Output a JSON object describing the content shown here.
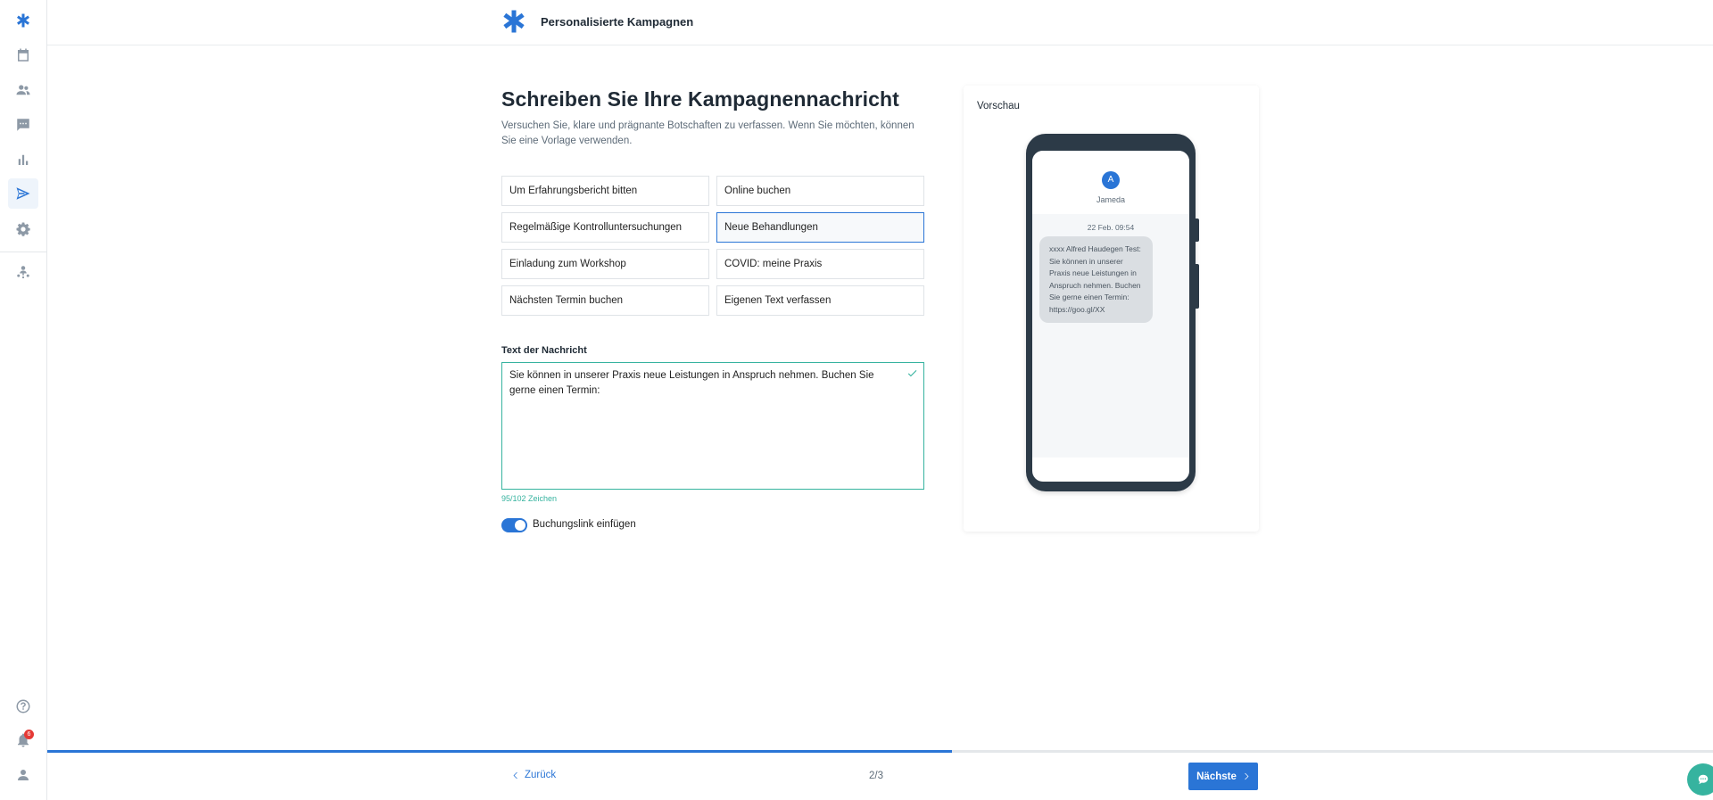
{
  "header": {
    "title": "Personalisierte Kampagnen"
  },
  "main": {
    "title": "Schreiben Sie Ihre Kampagnennachricht",
    "subtitle": "Versuchen Sie, klare und prägnante Botschaften zu verfassen. Wenn Sie möchten, können Sie eine Vorlage verwenden.",
    "templates": [
      {
        "label": "Um Erfahrungsbericht bitten",
        "selected": false
      },
      {
        "label": "Online buchen",
        "selected": false
      },
      {
        "label": "Regelmäßige Kontrolluntersuchungen",
        "selected": false
      },
      {
        "label": "Neue Behandlungen",
        "selected": true
      },
      {
        "label": "Einladung zum Workshop",
        "selected": false
      },
      {
        "label": "COVID: meine Praxis",
        "selected": false
      },
      {
        "label": "Nächsten Termin buchen",
        "selected": false
      },
      {
        "label": "Eigenen Text verfassen",
        "selected": false
      }
    ],
    "message_label": "Text der Nachricht",
    "message_value": "Sie können in unserer Praxis neue Leistungen in Anspruch nehmen. Buchen Sie gerne einen Termin:",
    "char_counter": "95/102 Zeichen",
    "toggle_label": "Buchungslink einfügen",
    "toggle_on": true
  },
  "preview": {
    "title": "Vorschau",
    "avatar_letter": "A",
    "contact_name": "Jameda",
    "timestamp": "22 Feb. 09:54",
    "message": "xxxx Alfred Haudegen Test: Sie können in unserer Praxis neue Leistungen in Anspruch nehmen. Buchen Sie gerne einen Termin: https://goo.gl/XX"
  },
  "footer": {
    "back_label": "Zurück",
    "step": "2/3",
    "next_label": "Nächste",
    "progress_fraction": 0.543
  },
  "sidebar": {
    "items": [
      "logo-icon",
      "calendar-icon",
      "users-icon",
      "chat-icon",
      "bar-chart-icon",
      "send-icon",
      "gear-icon",
      "team-icon"
    ],
    "active": "send-icon",
    "bottom": [
      "help-icon",
      "bell-icon",
      "user-icon"
    ],
    "notification_count": "6"
  },
  "colors": {
    "accent": "#2a75d6",
    "success": "#36b39f",
    "badge": "#e53935"
  }
}
